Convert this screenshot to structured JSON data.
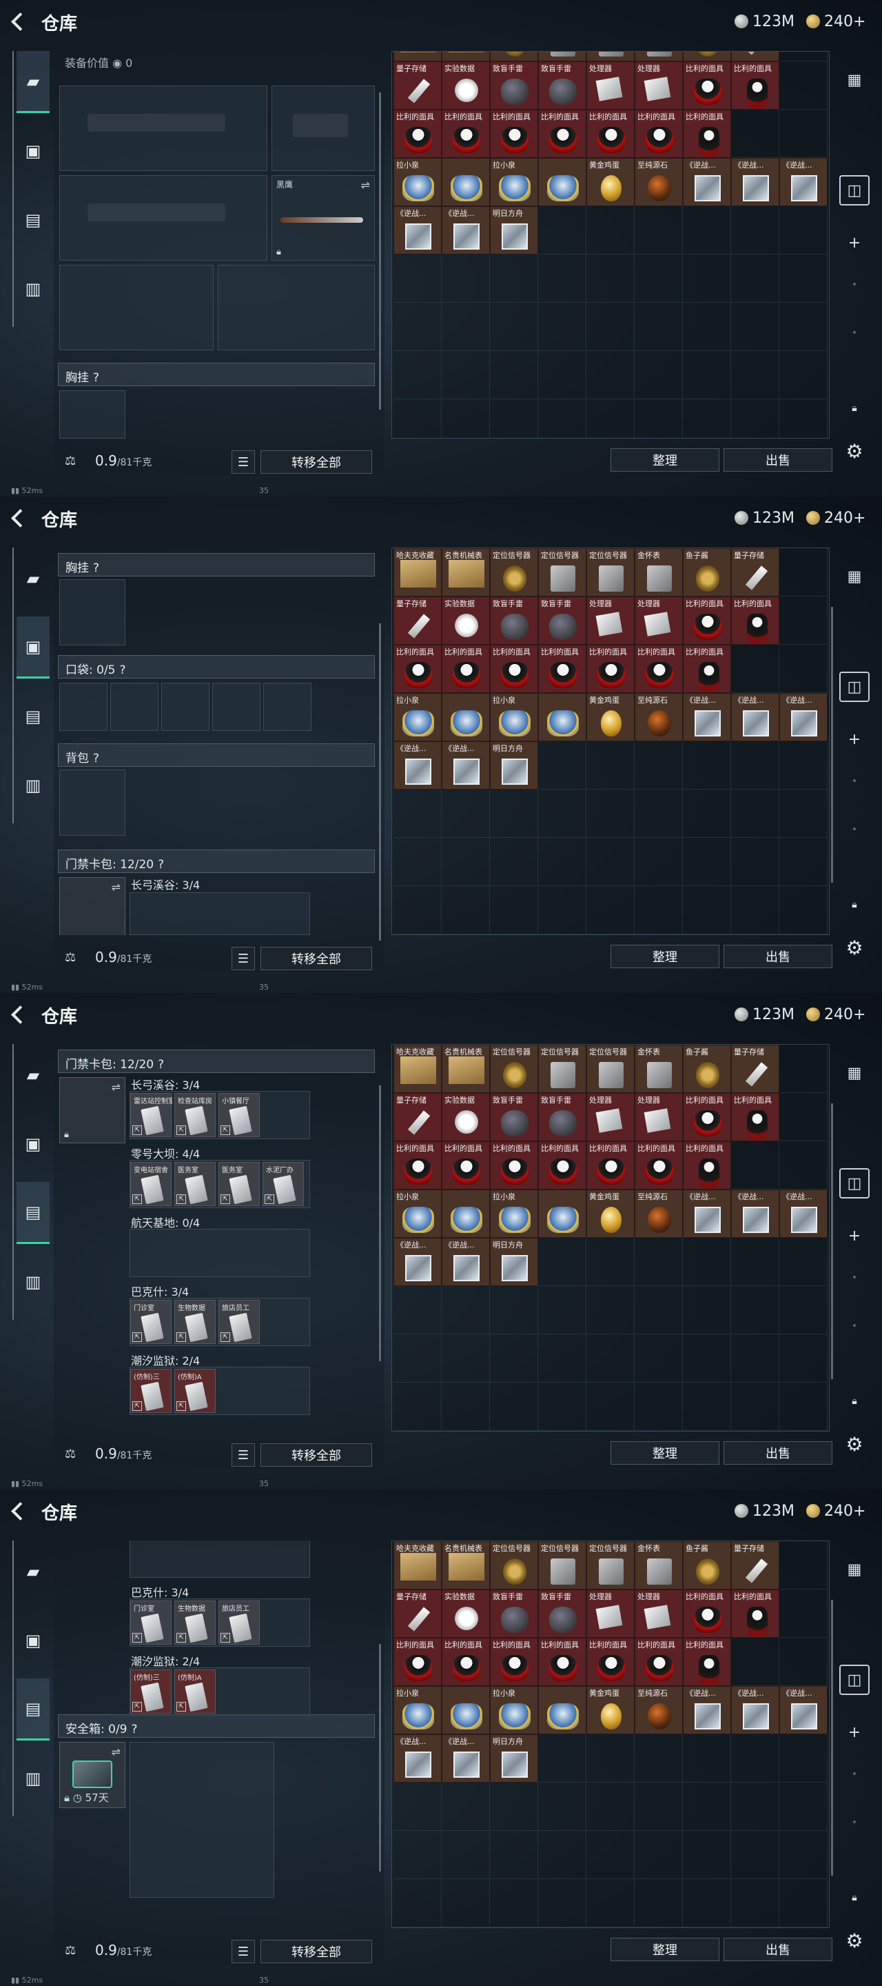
{
  "title": "仓库",
  "currency": {
    "silver": "123M",
    "gold": "240+"
  },
  "status": {
    "ping": "52ms",
    "n": "35"
  },
  "equip_value": {
    "label": "装备价值",
    "value": "0"
  },
  "knife_name": "黑鹰",
  "chest": {
    "label": "胸挂"
  },
  "pocket": {
    "label": "口袋: 0/5"
  },
  "backpack": {
    "label": "背包"
  },
  "keycard": {
    "label": "门禁卡包: 12/20"
  },
  "safebox": {
    "label": "安全箱: 0/9",
    "days": "57天"
  },
  "zones": [
    {
      "name": "长弓溪谷: 3/4",
      "cards": [
        "雷达站控制室",
        "检查站库房",
        "小镇餐厅"
      ]
    },
    {
      "name": "零号大坝: 4/4",
      "cards": [
        "变电站宿舍",
        "医务室",
        "医务室",
        "水泥厂办"
      ]
    },
    {
      "name": "航天基地: 0/4",
      "cards": []
    },
    {
      "name": "巴克什: 3/4",
      "cards": [
        "门诊室",
        "生物数据",
        "旅店员工"
      ]
    },
    {
      "name": "潮汐监狱: 2/4",
      "cards": [
        "(仿制)三",
        "(仿制)A"
      ]
    }
  ],
  "weight": {
    "current": "0.9",
    "max": "/81千克"
  },
  "buttons": {
    "transfer_all": "转移全部",
    "sort": "整理",
    "sell": "出售"
  },
  "grid_top_labels": [
    "哈夫克收藏",
    "名贵机械表",
    "定位信号器",
    "定位信号器",
    "定位信号器",
    "金怀表",
    "鱼子酱",
    "量子存储"
  ],
  "grid_rows": [
    [
      "量子存储",
      "实验数据",
      "致盲手雷",
      "致盲手雷",
      "处理器",
      "处理器",
      "比利的面具",
      "比利的面具"
    ],
    [
      "比利的面具",
      "比利的面具",
      "比利的面具",
      "比利的面具",
      "比利的面具",
      "比利的面具",
      "比利的面具",
      ""
    ],
    [
      "拉小泉",
      "",
      "拉小泉",
      "",
      "黄金鸡蛋",
      "至纯源石",
      "《逆战...",
      "《逆战..."
    ],
    [
      "《逆战...",
      "《逆战...",
      "明日方舟",
      "",
      "",
      "",
      "",
      ""
    ]
  ],
  "extra_cell": "《逆战..."
}
